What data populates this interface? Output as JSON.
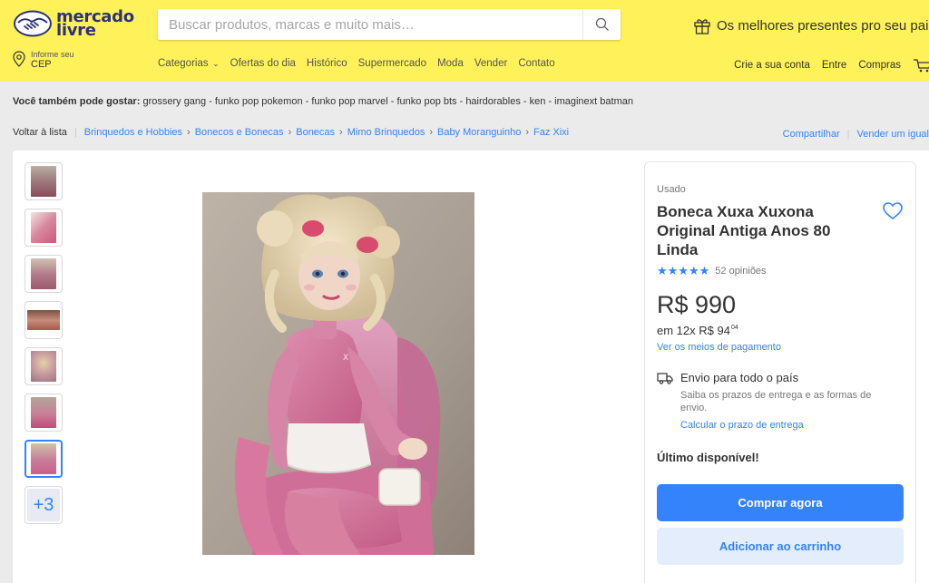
{
  "header": {
    "logo_line1": "mercado",
    "logo_line2": "livre",
    "search_placeholder": "Buscar produtos, marcas e muito mais…",
    "promo": "Os melhores presentes pro seu pai!",
    "cep_small": "Informe seu",
    "cep_big": "CEP",
    "nav": {
      "categories": "Categorias",
      "offers": "Ofertas do dia",
      "history": "Histórico",
      "supermarket": "Supermercado",
      "fashion": "Moda",
      "sell": "Vender",
      "contact": "Contato"
    },
    "account": {
      "create": "Crie a sua conta",
      "login": "Entre",
      "purchases": "Compras"
    }
  },
  "suggestions": {
    "label": "Você também pode gostar:",
    "items": "grossery gang - funko pop pokemon - funko pop marvel - funko pop bts - hairdorables - ken - imaginext batman"
  },
  "breadcrumb": {
    "back": "Voltar à lista",
    "items": [
      "Brinquedos e Hobbies",
      "Bonecos e Bonecas",
      "Bonecas",
      "Mimo Brinquedos",
      "Baby Moranguinho",
      "Faz Xixi"
    ],
    "share": "Compartilhar",
    "sell_same": "Vender um igual"
  },
  "gallery": {
    "more": "+3",
    "active_index": 6
  },
  "product": {
    "condition": "Usado",
    "title": "Boneca Xuxa Xuxona Original Antiga Anos 80 Linda",
    "stars": "★★★★★",
    "reviews": "52 opiniões",
    "price": "R$ 990",
    "installments_prefix": "em 12x R$ 94",
    "installments_cents": "04",
    "payment_link": "Ver os meios de pagamento",
    "shipping_title": "Envio para todo o país",
    "shipping_sub": "Saiba os prazos de entrega e as formas de envio.",
    "shipping_link": "Calcular o prazo de entrega",
    "stock": "Último disponível!",
    "buy_now": "Comprar agora",
    "add_to_cart": "Adicionar ao carrinho"
  },
  "colors": {
    "header_bg": "#fff159",
    "accent": "#3483fa",
    "logo": "#2d3277"
  }
}
